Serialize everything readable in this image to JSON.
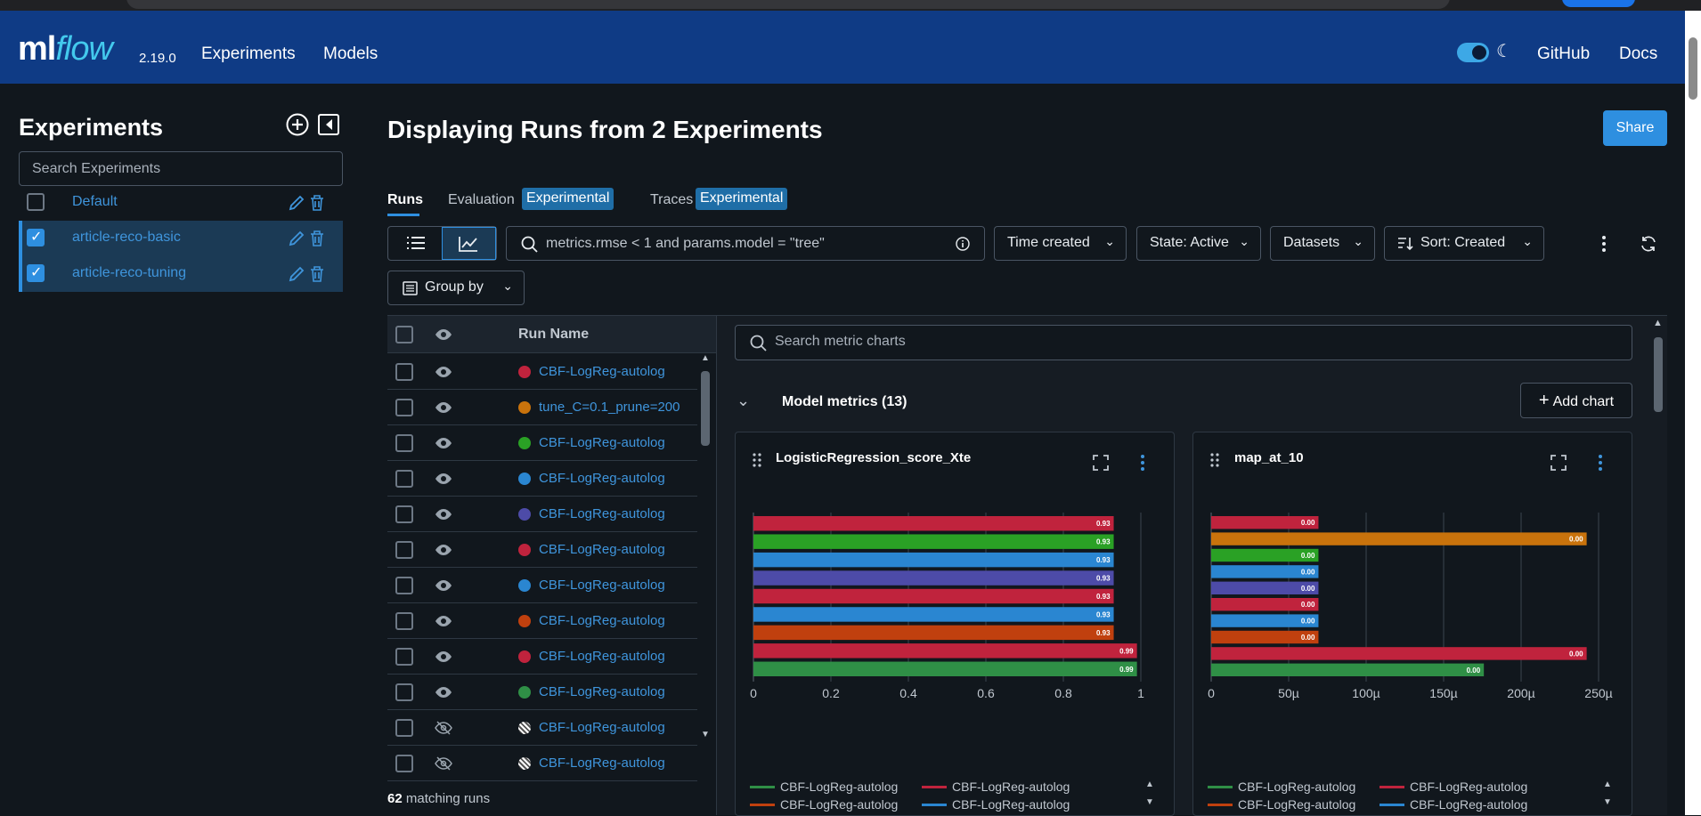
{
  "app": {
    "logo_ml": "ml",
    "logo_flow": "flow",
    "version": "2.19.0",
    "nav": [
      "Experiments",
      "Models"
    ],
    "right_links": [
      "GitHub",
      "Docs"
    ]
  },
  "sidebar": {
    "title": "Experiments",
    "search_placeholder": "Search Experiments",
    "experiments": [
      {
        "name": "Default",
        "checked": false
      },
      {
        "name": "article-reco-basic",
        "checked": true
      },
      {
        "name": "article-reco-tuning",
        "checked": true
      }
    ]
  },
  "main": {
    "title": "Displaying Runs from 2 Experiments",
    "share_label": "Share",
    "tabs": [
      {
        "label": "Runs",
        "badge": ""
      },
      {
        "label": "Evaluation",
        "badge": "Experimental"
      },
      {
        "label": "Traces",
        "badge": "Experimental"
      }
    ],
    "filter_placeholder": "metrics.rmse < 1 and params.model = \"tree\"",
    "dropdowns": [
      "Time created",
      "State: Active",
      "Datasets",
      "Sort: Created"
    ],
    "group_by": "Group by"
  },
  "runs": {
    "header": "Run Name",
    "rows": [
      {
        "name": "CBF-LogReg-autolog",
        "color": "#c0233d",
        "hidden": false
      },
      {
        "name": "tune_C=0.1_prune=200",
        "color": "#c9730c",
        "hidden": false
      },
      {
        "name": "CBF-LogReg-autolog",
        "color": "#2aa125",
        "hidden": false
      },
      {
        "name": "CBF-LogReg-autolog",
        "color": "#2a86d1",
        "hidden": false
      },
      {
        "name": "CBF-LogReg-autolog",
        "color": "#4d4ba8",
        "hidden": false
      },
      {
        "name": "CBF-LogReg-autolog",
        "color": "#c0233d",
        "hidden": false
      },
      {
        "name": "CBF-LogReg-autolog",
        "color": "#2a86d1",
        "hidden": false
      },
      {
        "name": "CBF-LogReg-autolog",
        "color": "#c0400e",
        "hidden": false
      },
      {
        "name": "CBF-LogReg-autolog",
        "color": "#c0233d",
        "hidden": false
      },
      {
        "name": "CBF-LogReg-autolog",
        "color": "#2f8f46",
        "hidden": false
      },
      {
        "name": "CBF-LogReg-autolog",
        "color": "striped",
        "hidden": true
      },
      {
        "name": "CBF-LogReg-autolog",
        "color": "striped",
        "hidden": true
      }
    ],
    "matching_count": "62",
    "matching_text": "matching runs"
  },
  "charts": {
    "search_placeholder": "Search metric charts",
    "section_title": "Model metrics (13)",
    "add_chart_label": "Add chart",
    "legend": [
      {
        "name": "CBF-LogReg-autolog",
        "color": "#2f8f46"
      },
      {
        "name": "CBF-LogReg-autolog",
        "color": "#c0233d"
      },
      {
        "name": "CBF-LogReg-autolog",
        "color": "#c0400e"
      },
      {
        "name": "CBF-LogReg-autolog",
        "color": "#2a86d1"
      }
    ]
  },
  "chart_data": [
    {
      "type": "bar",
      "orientation": "horizontal",
      "title": "LogisticRegression_score_Xte",
      "xlim": [
        0,
        1
      ],
      "xticks": [
        "0",
        "0.2",
        "0.4",
        "0.6",
        "0.8",
        "1"
      ],
      "values": [
        0.93,
        0.93,
        0.93,
        0.93,
        0.93,
        0.93,
        0.93,
        0.99,
        0.99
      ],
      "labels": [
        "0.93",
        "0.93",
        "0.93",
        "0.93",
        "0.93",
        "0.93",
        "0.93",
        "0.99",
        "0.99"
      ],
      "colors": [
        "#c0233d",
        "#2aa125",
        "#2a86d1",
        "#4d4ba8",
        "#c0233d",
        "#2a86d1",
        "#c0400e",
        "#c0233d",
        "#2f8f46"
      ]
    },
    {
      "type": "bar",
      "orientation": "horizontal",
      "title": "map_at_10",
      "xlim": [
        0,
        0.00026
      ],
      "xticks": [
        "0",
        "50µ",
        "100µ",
        "150µ",
        "200µ",
        "250µ"
      ],
      "values": [
        7.2e-05,
        0.000252,
        7.2e-05,
        7.2e-05,
        7.2e-05,
        7.2e-05,
        7.2e-05,
        7.2e-05,
        0.000252,
        0.000183
      ],
      "labels": [
        "0.00",
        "0.00",
        "0.00",
        "0.00",
        "0.00",
        "0.00",
        "0.00",
        "0.00",
        "0.00",
        "0.00"
      ],
      "colors": [
        "#c0233d",
        "#c9730c",
        "#2aa125",
        "#2a86d1",
        "#4d4ba8",
        "#c0233d",
        "#2a86d1",
        "#c0400e",
        "#c0233d",
        "#2f8f46"
      ]
    }
  ]
}
